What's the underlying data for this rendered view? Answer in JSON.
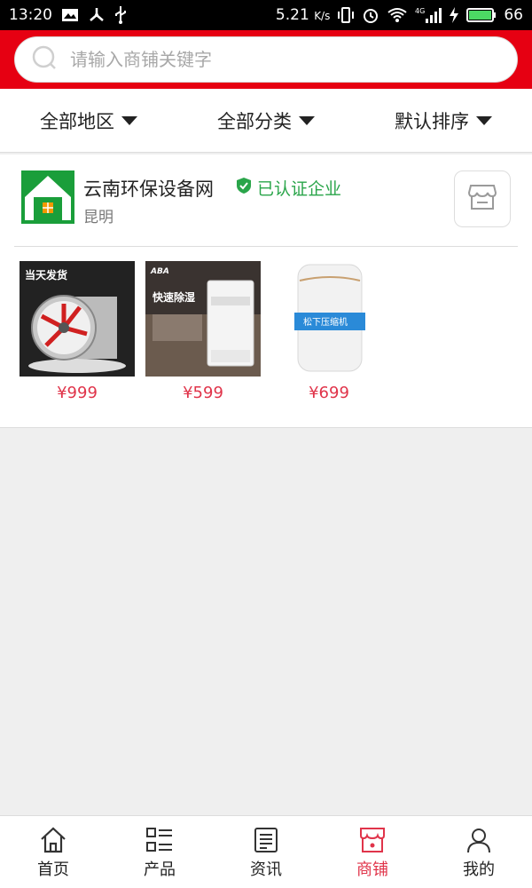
{
  "status_bar": {
    "time": "13:20",
    "speed": "5.21",
    "speed_unit": "K/s",
    "network": "4G",
    "battery": "66"
  },
  "search": {
    "placeholder": "请输入商铺关键字"
  },
  "filters": [
    {
      "label": "全部地区"
    },
    {
      "label": "全部分类"
    },
    {
      "label": "默认排序"
    }
  ],
  "shop": {
    "name": "云南环保设备网",
    "verified_label": "已认证企业",
    "city": "昆明",
    "products": [
      {
        "price": "¥999",
        "overlay_text": "当天发货",
        "image": "axial-fan"
      },
      {
        "price": "¥599",
        "overlay_text": "快速除湿",
        "brand": "ABA",
        "image": "dehumidifier"
      },
      {
        "price": "¥699",
        "overlay_text": "松下压缩机",
        "image": "dehumidifier-white"
      }
    ]
  },
  "bottom_nav": [
    {
      "label": "首页",
      "icon": "home-icon"
    },
    {
      "label": "产品",
      "icon": "grid-list-icon"
    },
    {
      "label": "资讯",
      "icon": "news-icon"
    },
    {
      "label": "商铺",
      "icon": "store-icon",
      "active": true
    },
    {
      "label": "我的",
      "icon": "user-icon"
    }
  ],
  "colors": {
    "brand_red": "#e60012",
    "price_red": "#e0344a",
    "verified_green": "#2aa54a"
  }
}
